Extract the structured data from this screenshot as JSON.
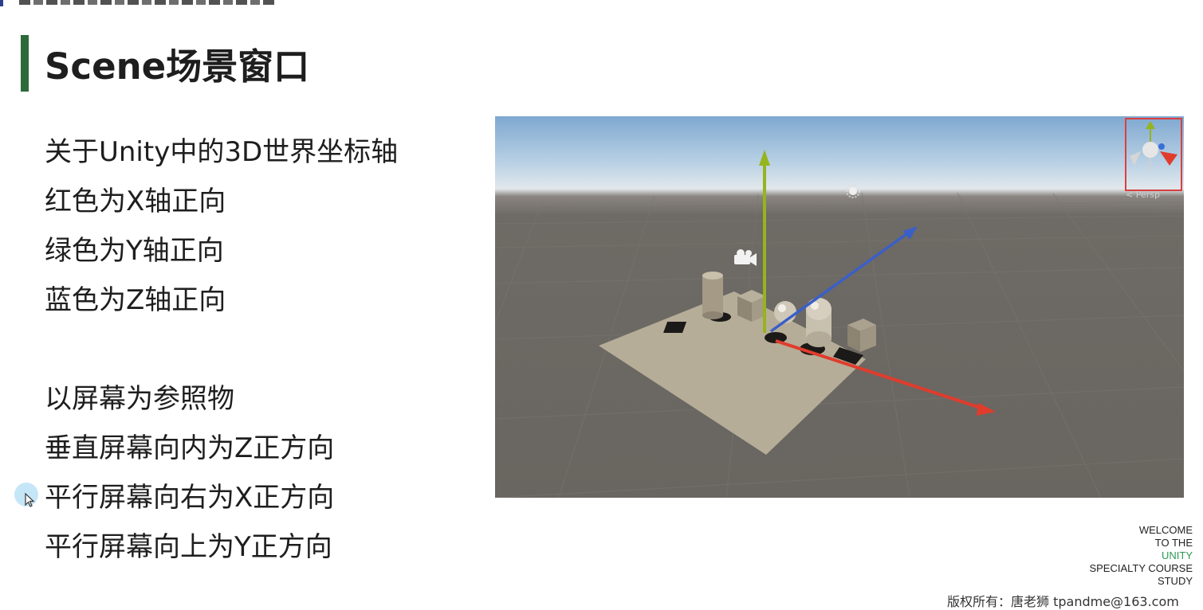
{
  "slide": {
    "title": "Scene场景窗口",
    "accent_color": "#2d6a3a"
  },
  "bullets": [
    "关于Unity中的3D世界坐标轴",
    "红色为X轴正向",
    "绿色为Y轴正向",
    "蓝色为Z轴正向",
    "以屏幕为参照物",
    "垂直屏幕向内为Z正方向",
    "平行屏幕向右为X正方向",
    "平行屏幕向上为Y正方向"
  ],
  "scene_view": {
    "projection_label": "< Persp",
    "gizmo_highlight_color": "#d94040",
    "axis_colors": {
      "x": "#e03c2c",
      "y": "#96b41e",
      "z": "#3a5fc8"
    },
    "icons": [
      "camera-icon",
      "sun-light-icon",
      "orientation-gizmo-icon"
    ]
  },
  "branding": {
    "line1": "WELCOME",
    "line2": "TO THE",
    "line3": "UNITY",
    "line4": "SPECIALTY COURSE",
    "line5": "STUDY",
    "accent_color": "#2c9a54"
  },
  "footer": {
    "copyright": "版权所有：唐老狮 tpandme@163.com"
  }
}
